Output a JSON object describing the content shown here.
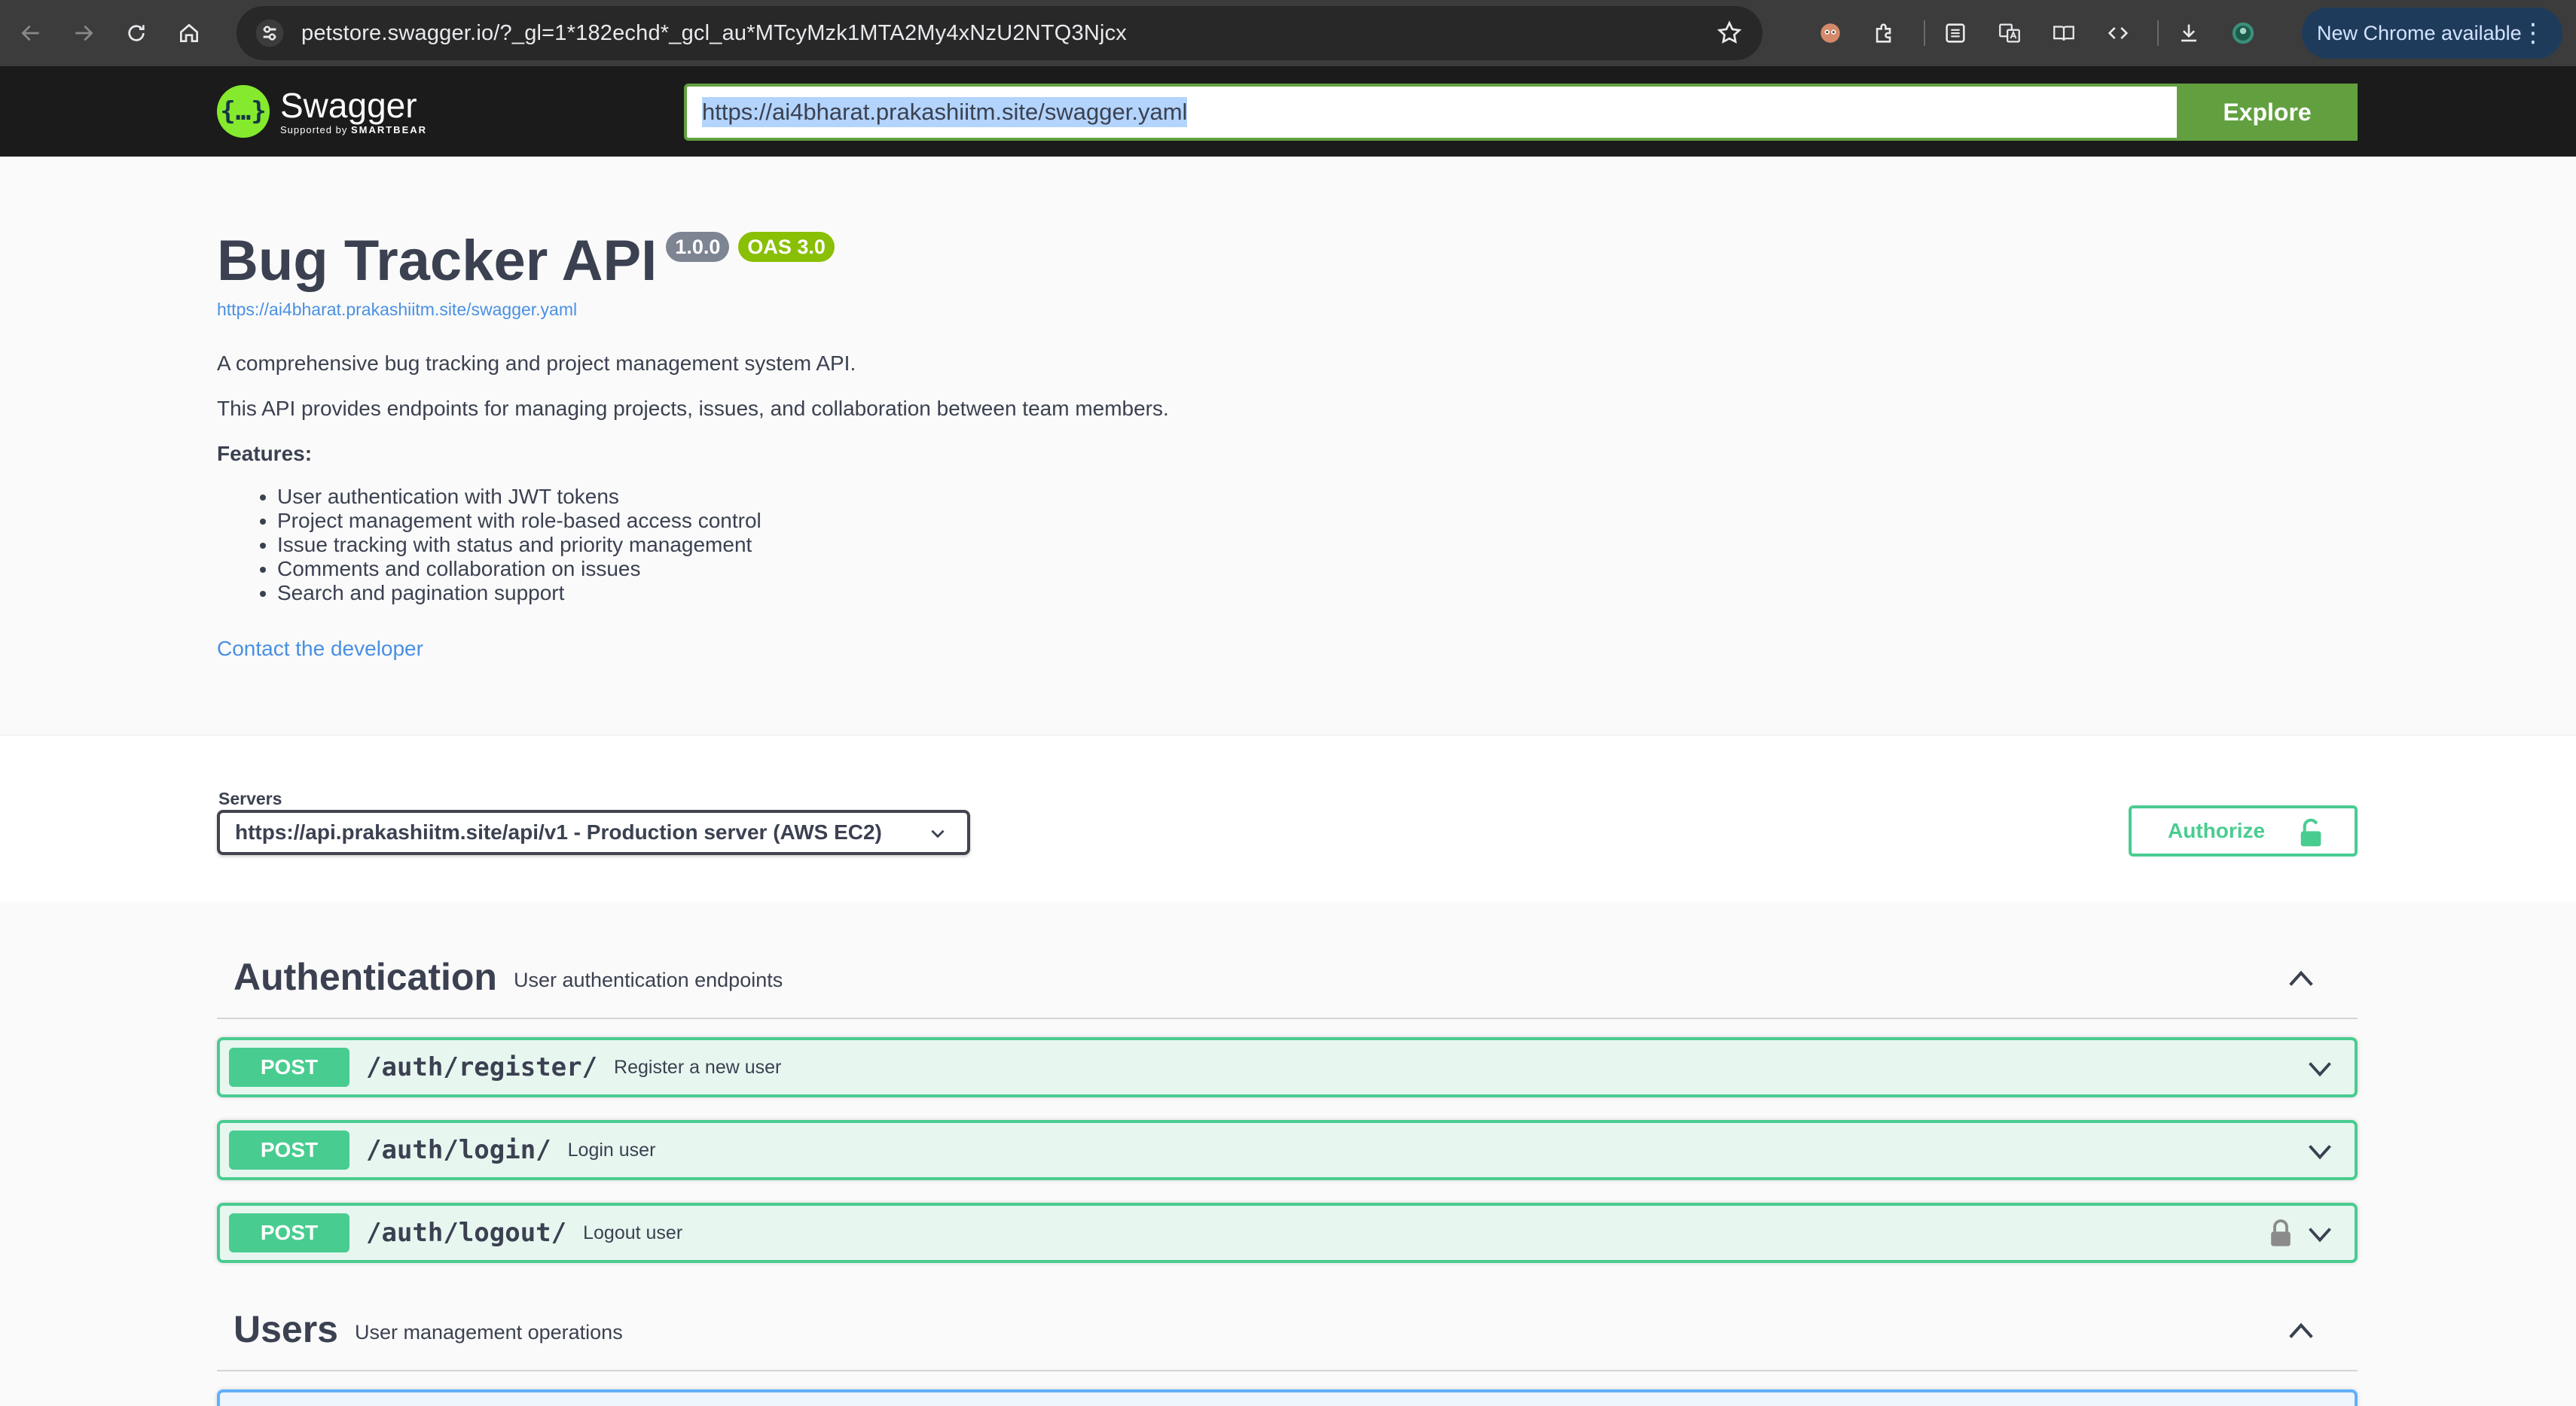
{
  "browser": {
    "url": "petstore.swagger.io/?_gl=1*182echd*_gcl_au*MTcyMzk1MTA2My4xNzU2NTQ3Njcx",
    "update_label": "New Chrome available"
  },
  "topbar": {
    "logo_name": "Swagger",
    "logo_sub_prefix": "Supported by",
    "logo_sub_brand": "SMARTBEAR",
    "spec_url_value": "https://ai4bharat.prakashiitm.site/swagger.yaml",
    "explore_label": "Explore"
  },
  "info": {
    "title": "Bug Tracker API",
    "version": "1.0.0",
    "oas": "OAS 3.0",
    "spec_link": "https://ai4bharat.prakashiitm.site/swagger.yaml",
    "description_1": "A comprehensive bug tracking and project management system API.",
    "description_2": "This API provides endpoints for managing projects, issues, and collaboration between team members.",
    "features_heading": "Features:",
    "features": [
      "User authentication with JWT tokens",
      "Project management with role-based access control",
      "Issue tracking with status and priority management",
      "Comments and collaboration on issues",
      "Search and pagination support"
    ],
    "contact_label": "Contact the developer"
  },
  "servers": {
    "label": "Servers",
    "selected": "https://api.prakashiitm.site/api/v1 - Production server (AWS EC2)",
    "authorize_label": "Authorize"
  },
  "tags": [
    {
      "name": "Authentication",
      "description": "User authentication endpoints",
      "operations": [
        {
          "method": "POST",
          "path": "/auth/register/",
          "summary": "Register a new user",
          "locked": false
        },
        {
          "method": "POST",
          "path": "/auth/login/",
          "summary": "Login user",
          "locked": false
        },
        {
          "method": "POST",
          "path": "/auth/logout/",
          "summary": "Logout user",
          "locked": true
        }
      ]
    },
    {
      "name": "Users",
      "description": "User management operations",
      "operations": []
    }
  ],
  "colors": {
    "post": "#49cc90",
    "post_bg": "#e8f6f0",
    "swagger_green": "#62a03f",
    "link": "#4990e2",
    "badge_version": "#7d8492",
    "badge_oas": "#89bf04"
  },
  "icons": [
    "back-arrow-icon",
    "forward-arrow-icon",
    "reload-icon",
    "home-icon",
    "site-settings-icon",
    "bookmark-star-icon",
    "extension-icon",
    "translate-icon",
    "reading-mode-icon",
    "code-icon",
    "download-icon",
    "profile-avatar-icon",
    "menu-dots-icon",
    "chevron-down-icon",
    "chevron-up-icon",
    "lock-icon"
  ]
}
